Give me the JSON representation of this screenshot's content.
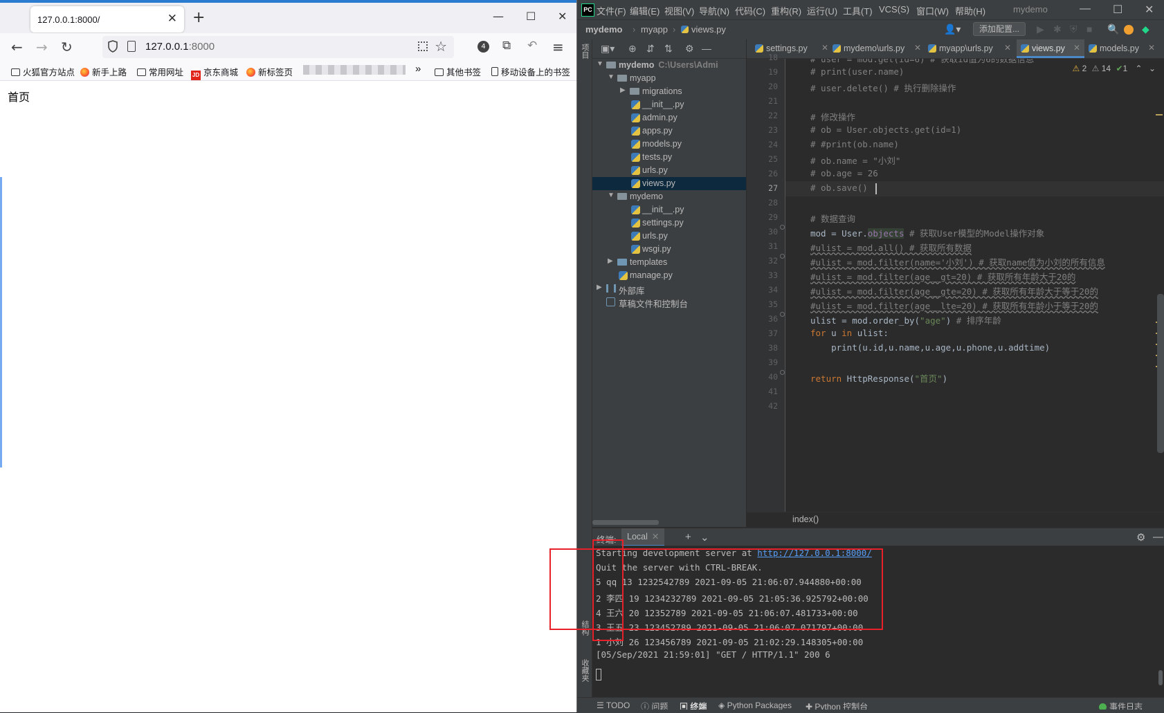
{
  "browser": {
    "tab_title": "127.0.0.1:8000/",
    "url_host": "127.0.0.1",
    "url_port": ":8000",
    "bookmarks": [
      "火狐官方站点",
      "新手上路",
      "常用网址",
      "京东商城",
      "新标签页"
    ],
    "bookmarks_right": [
      "其他书签",
      "移动设备上的书签"
    ],
    "badge_count": "4",
    "page_text": "首页"
  },
  "ide": {
    "logo": "PC",
    "menus": [
      "文件(F)",
      "编辑(E)",
      "视图(V)",
      "导航(N)",
      "代码(C)",
      "重构(R)",
      "运行(U)",
      "工具(T)",
      "VCS(S)",
      "窗口(W)",
      "帮助(H)"
    ],
    "window_title": "mydemo",
    "nav_crumbs": [
      "mydemo",
      "myapp",
      "views.py"
    ],
    "add_config": "添加配置...",
    "left_tool_project": "项目",
    "left_tool_structure": "结构",
    "left_tool_favorites": "收藏夹",
    "tree": [
      {
        "label": "mydemo",
        "path": "C:\\Users\\Admi"
      },
      {
        "label": "myapp"
      },
      {
        "label": "migrations"
      },
      {
        "label": "__init__.py"
      },
      {
        "label": "admin.py"
      },
      {
        "label": "apps.py"
      },
      {
        "label": "models.py"
      },
      {
        "label": "tests.py"
      },
      {
        "label": "urls.py"
      },
      {
        "label": "views.py"
      },
      {
        "label": "mydemo"
      },
      {
        "label": "__init__.py"
      },
      {
        "label": "settings.py"
      },
      {
        "label": "urls.py"
      },
      {
        "label": "wsgi.py"
      },
      {
        "label": "templates"
      },
      {
        "label": "manage.py"
      },
      {
        "label": "外部库"
      },
      {
        "label": "草稿文件和控制台"
      }
    ],
    "editor_tabs": [
      "settings.py",
      "mydemo\\urls.py",
      "myapp\\urls.py",
      "views.py",
      "models.py"
    ],
    "inspections": {
      "warnings": "2",
      "weak": "14",
      "ok": "1"
    },
    "line_numbers": [
      "18",
      "19",
      "20",
      "21",
      "22",
      "23",
      "24",
      "25",
      "26",
      "27",
      "28",
      "29",
      "30",
      "31",
      "32",
      "33",
      "34",
      "35",
      "36",
      "37",
      "38",
      "39",
      "40",
      "41",
      "42"
    ],
    "code": {
      "l18": "# user = mod.get(id=6) # 获取id值为6的数据信息",
      "l19": "# print(user.name)",
      "l20": "# user.delete() # 执行删除操作",
      "l22": "# 修改操作",
      "l23": "# ob = User.objects.get(id=1)",
      "l24": "# #print(ob.name)",
      "l25": "# ob.name = \"小刘\"",
      "l26": "# ob.age = 26",
      "l27": "# ob.save()",
      "l29": "# 数据查询",
      "l30_a": "mod = User.",
      "l30_b": "objects",
      "l30_c": " # 获取User模型的Model操作对象",
      "l31": "#ulist = mod.all() # 获取所有数据",
      "l32": "#ulist = mod.filter(name='小刘') # 获取name值为小刘的所有信息",
      "l33": "#ulist = mod.filter(age__gt=20) # 获取所有年龄大于20的",
      "l34": "#ulist = mod.filter(age__gte=20) # 获取所有年龄大于等于20的",
      "l35": "#ulist = mod.filter(age__lte=20) # 获取所有年龄小于等于20的",
      "l36_a": "ulist = mod.order_by(",
      "l36_b": "\"age\"",
      "l36_c": ") ",
      "l36_d": "# 排序年龄",
      "l37_a": "for",
      "l37_b": " u ",
      "l37_c": "in",
      "l37_d": " ulist:",
      "l38": "    print(u.id,u.name,u.age,u.phone,u.addtime)",
      "l40_a": "return",
      "l40_b": " HttpResponse(",
      "l40_c": "\"首页\"",
      "l40_d": ")"
    },
    "breadcrumb": "index()",
    "terminal": {
      "title": "终端:",
      "tab": "Local",
      "line1_prefix": "Starting development server at ",
      "line1_link": "http://127.0.0.1:8000/",
      "line2": "Quit the server with CTRL-BREAK.",
      "rows": [
        "5 qq 13 1232542789 2021-09-05 21:06:07.944880+00:00",
        "2 李四 19 1234232789 2021-09-05 21:05:36.925792+00:00",
        "4 王六 20 12352789 2021-09-05 21:06:07.481733+00:00",
        "3 王五 23 123452789 2021-09-05 21:06:07.071797+00:00",
        "1 小刘 26 123456789 2021-09-05 21:02:29.148305+00:00"
      ],
      "log": "[05/Sep/2021 21:59:01] \"GET / HTTP/1.1\" 200 6"
    },
    "bottom_tools": [
      "TODO",
      "问题",
      "终端",
      "Python Packages",
      "Python 控制台",
      "事件日志"
    ]
  }
}
